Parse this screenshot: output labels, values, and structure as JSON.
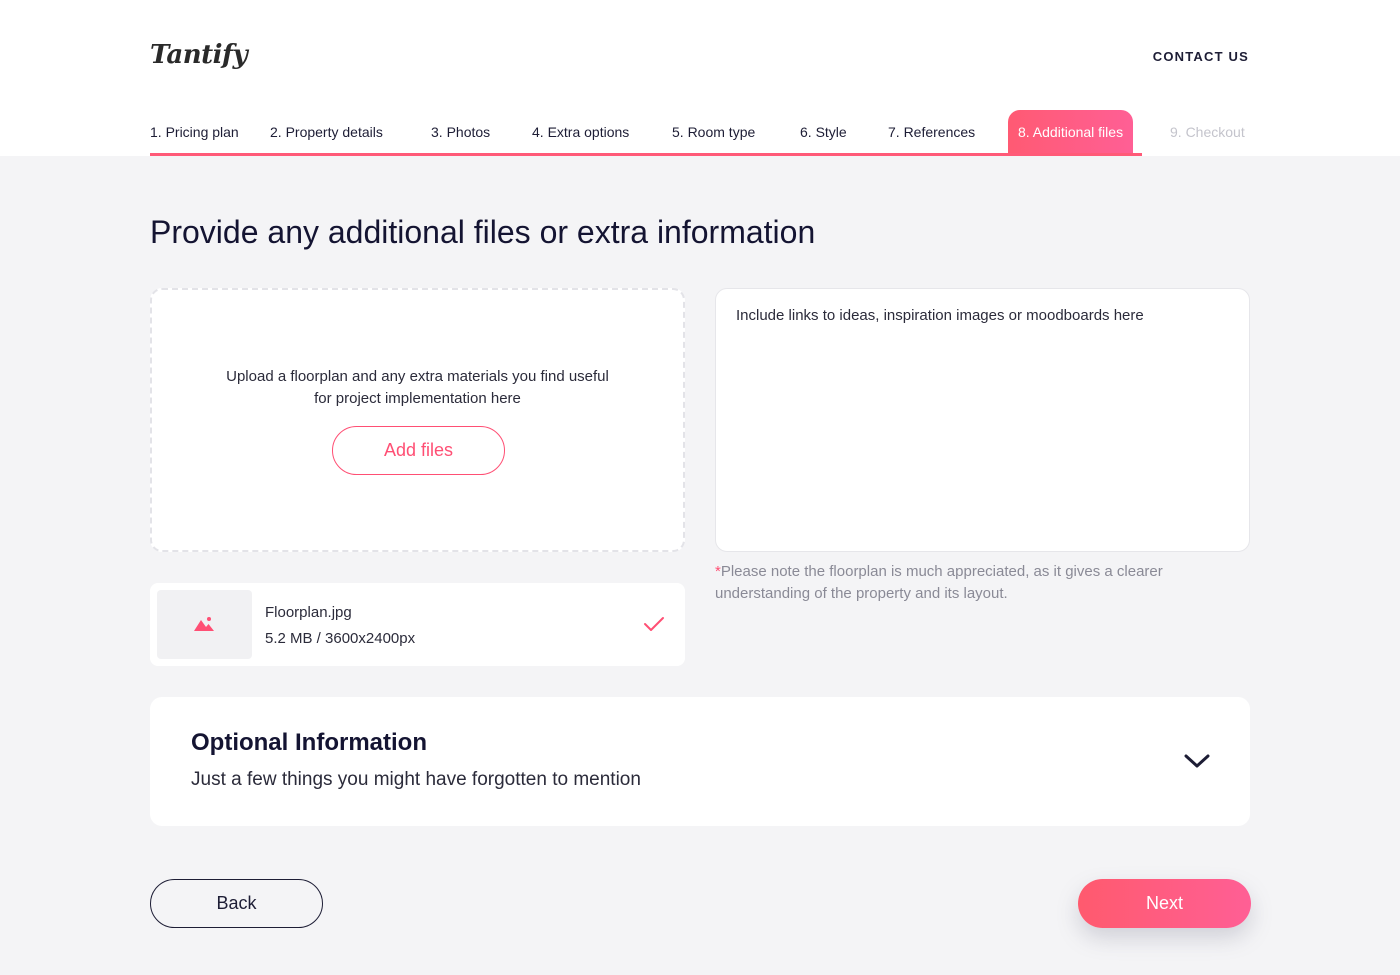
{
  "header": {
    "logo": "Tantify",
    "contact_label": "CONTACT US"
  },
  "steps": [
    {
      "label": "1. Pricing plan",
      "state": "done"
    },
    {
      "label": "2. Property details",
      "state": "done"
    },
    {
      "label": "3. Photos",
      "state": "done"
    },
    {
      "label": "4. Extra options",
      "state": "done"
    },
    {
      "label": "5. Room type",
      "state": "done"
    },
    {
      "label": "6. Style",
      "state": "done"
    },
    {
      "label": "7. References",
      "state": "done"
    },
    {
      "label": "8. Additional files",
      "state": "active"
    },
    {
      "label": "9. Checkout",
      "state": "future"
    }
  ],
  "page_title": "Provide any additional files or extra information",
  "upload": {
    "text": "Upload a floorplan and any extra materials you find useful for project implementation here",
    "button_label": "Add files"
  },
  "file": {
    "name": "Floorplan.jpg",
    "meta": "5.2 MB / 3600x2400px",
    "icon": "image-icon",
    "status_icon": "check-icon"
  },
  "notes": {
    "placeholder": "Include links to ideas, inspiration images or moodboards here",
    "value": ""
  },
  "note": {
    "asterisk": "*",
    "text": "Please note the floorplan is much appreciated, as it gives a clearer understanding of the property and its layout."
  },
  "optional": {
    "title": "Optional Information",
    "subtitle": "Just a few things you might have forgotten to mention",
    "icon": "chevron-down-icon"
  },
  "nav": {
    "back_label": "Back",
    "next_label": "Next"
  },
  "colors": {
    "accent": "#ff4f74",
    "accent_gradient_end": "#ff5f95",
    "text_dark": "#141432",
    "background": "#f4f4f6"
  }
}
